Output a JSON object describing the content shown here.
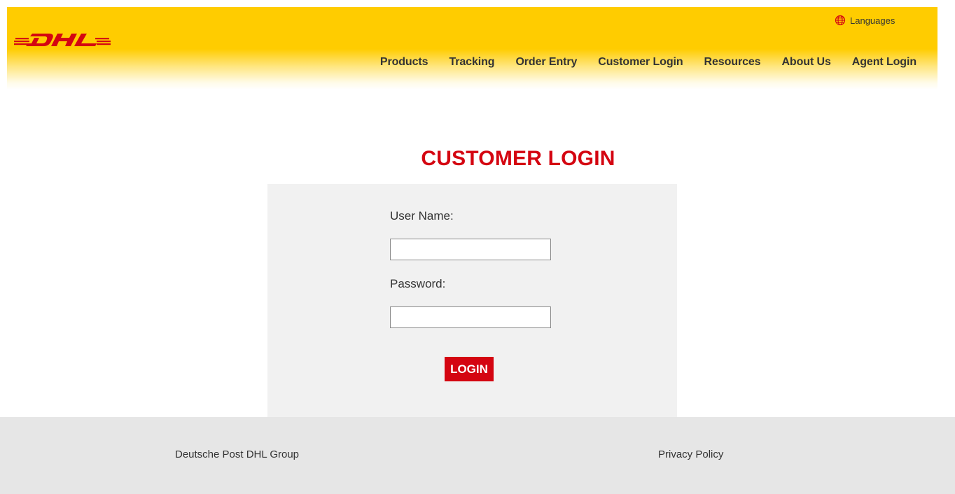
{
  "header": {
    "logo_alt": "DHL",
    "languages_label": "Languages",
    "nav": [
      {
        "label": "Products"
      },
      {
        "label": "Tracking"
      },
      {
        "label": "Order Entry"
      },
      {
        "label": "Customer Login"
      },
      {
        "label": "Resources"
      },
      {
        "label": "About Us"
      },
      {
        "label": "Agent Login"
      }
    ]
  },
  "main": {
    "title": "CUSTOMER LOGIN",
    "username_label": "User Name:",
    "username_value": "",
    "password_label": "Password:",
    "password_value": "",
    "login_button": "LOGIN"
  },
  "footer": {
    "left_link": "Deutsche Post DHL Group",
    "right_link": "Privacy Policy"
  },
  "colors": {
    "brand_yellow": "#ffcc00",
    "brand_red": "#d40511",
    "panel_bg": "#f1f1f1",
    "footer_bg": "#e6e6e6"
  },
  "icons": [
    "dhl-logo",
    "globe-icon"
  ]
}
